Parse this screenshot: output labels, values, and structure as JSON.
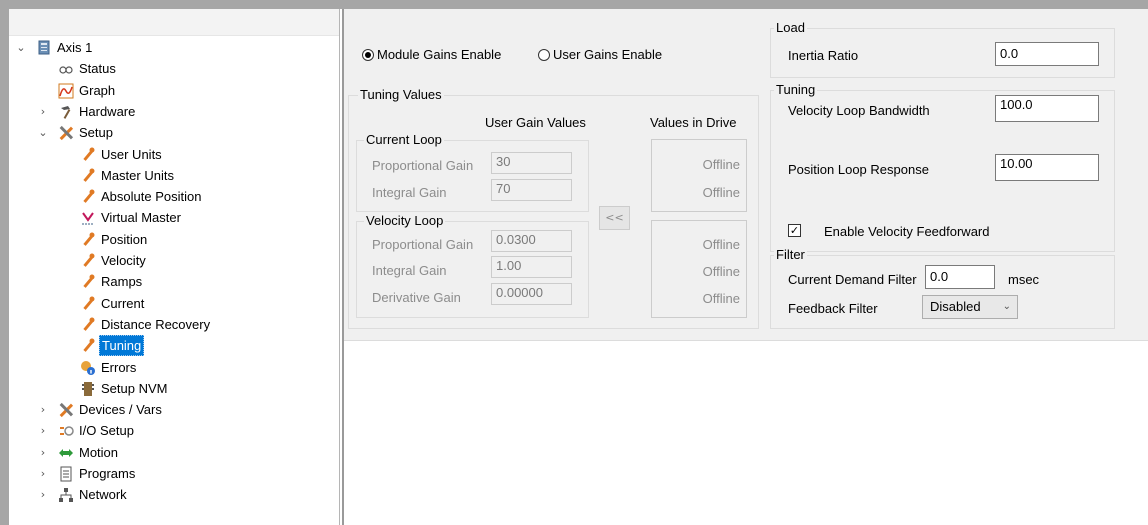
{
  "tree": {
    "items": [
      {
        "label": "Axis 1",
        "icon": "drive-icon",
        "expander": "⌄"
      },
      {
        "label": "Status",
        "icon": "status-icon",
        "expander": ""
      },
      {
        "label": "Graph",
        "icon": "graph-icon",
        "expander": ""
      },
      {
        "label": "Hardware",
        "icon": "hammer-icon",
        "expander": "›"
      },
      {
        "label": "Setup",
        "icon": "tools-icon",
        "expander": "⌄"
      },
      {
        "label": "User Units",
        "icon": "wrench-icon",
        "expander": ""
      },
      {
        "label": "Master Units",
        "icon": "wrench-icon",
        "expander": ""
      },
      {
        "label": "Absolute Position",
        "icon": "wrench-icon",
        "expander": ""
      },
      {
        "label": "Virtual Master",
        "icon": "virtual-master-icon",
        "expander": ""
      },
      {
        "label": "Position",
        "icon": "wrench-icon",
        "expander": ""
      },
      {
        "label": "Velocity",
        "icon": "wrench-icon",
        "expander": ""
      },
      {
        "label": "Ramps",
        "icon": "wrench-icon",
        "expander": ""
      },
      {
        "label": "Current",
        "icon": "wrench-icon",
        "expander": ""
      },
      {
        "label": "Distance Recovery",
        "icon": "wrench-icon",
        "expander": ""
      },
      {
        "label": "Tuning",
        "icon": "wrench-icon",
        "expander": ""
      },
      {
        "label": "Errors",
        "icon": "errors-icon",
        "expander": ""
      },
      {
        "label": "Setup NVM",
        "icon": "nvm-icon",
        "expander": ""
      },
      {
        "label": "Devices / Vars",
        "icon": "tools-icon",
        "expander": "›"
      },
      {
        "label": "I/O Setup",
        "icon": "io-icon",
        "expander": "›"
      },
      {
        "label": "Motion",
        "icon": "motion-icon",
        "expander": "›"
      },
      {
        "label": "Programs",
        "icon": "programs-icon",
        "expander": "›"
      },
      {
        "label": "Network",
        "icon": "network-icon",
        "expander": "›"
      }
    ]
  },
  "gains": {
    "module_label": "Module Gains Enable",
    "user_label": "User Gains Enable",
    "selected": "module"
  },
  "tuning_values": {
    "title": "Tuning Values",
    "user_gain_header": "User Gain Values",
    "drive_header": "Values in Drive",
    "copy_button": "<<",
    "current_loop": {
      "title": "Current Loop",
      "prop_label": "Proportional Gain",
      "prop_value": "30",
      "int_label": "Integral Gain",
      "int_value": "70",
      "prop_drive": "Offline",
      "int_drive": "Offline"
    },
    "velocity_loop": {
      "title": "Velocity Loop",
      "prop_label": "Proportional Gain",
      "prop_value": "0.0300",
      "int_label": "Integral Gain",
      "int_value": "1.00",
      "deriv_label": "Derivative Gain",
      "deriv_value": "0.00000",
      "prop_drive": "Offline",
      "int_drive": "Offline",
      "deriv_drive": "Offline"
    }
  },
  "load": {
    "title": "Load",
    "inertia_label": "Inertia Ratio",
    "inertia_value": "0.0"
  },
  "tuning": {
    "title": "Tuning",
    "vel_bw_label": "Velocity Loop Bandwidth",
    "vel_bw_value": "100.0",
    "pos_resp_label": "Position Loop Response",
    "pos_resp_value": "10.00",
    "feedforward_label": "Enable Velocity Feedforward",
    "feedforward_checked": true
  },
  "filter": {
    "title": "Filter",
    "cdf_label": "Current Demand Filter",
    "cdf_value": "0.0",
    "cdf_unit": "msec",
    "fb_label": "Feedback Filter",
    "fb_value": "Disabled"
  }
}
